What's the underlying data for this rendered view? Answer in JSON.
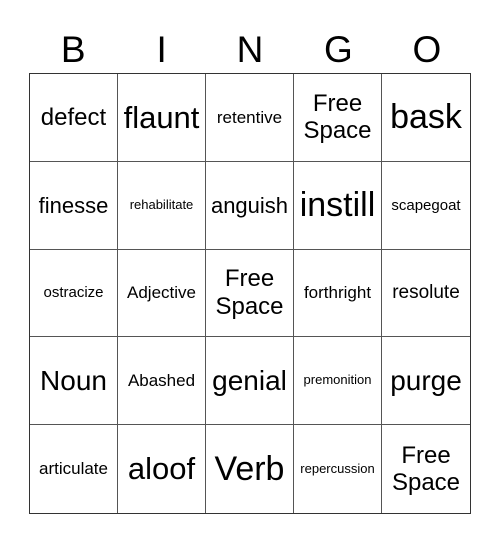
{
  "header": [
    "B",
    "I",
    "N",
    "G",
    "O"
  ],
  "cells": [
    "defect",
    "flaunt",
    "retentive",
    "Free Space",
    "bask",
    "finesse",
    "rehabilitate",
    "anguish",
    "instill",
    "scapegoat",
    "ostracize",
    "Adjective",
    "Free Space",
    "forthright",
    "resolute",
    "Noun",
    "Abashed",
    "genial",
    "premonition",
    "purge",
    "articulate",
    "aloof",
    "Verb",
    "repercussion",
    "Free Space"
  ]
}
